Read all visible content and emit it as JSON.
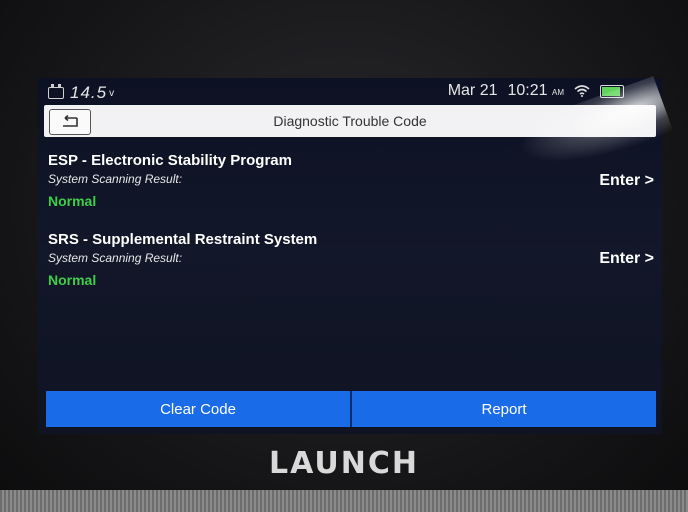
{
  "status_bar": {
    "voltage": "14.5",
    "voltage_unit": "v",
    "date": "Mar 21",
    "time": "10:21",
    "ampm": "AM",
    "battery_level": 0.8
  },
  "header": {
    "title": "Diagnostic Trouble Code"
  },
  "systems": [
    {
      "name": "ESP - Electronic Stability Program",
      "result_label": "System Scanning Result:",
      "result": "Normal",
      "action": "Enter >"
    },
    {
      "name": "SRS - Supplemental Restraint System",
      "result_label": "System Scanning Result:",
      "result": "Normal",
      "action": "Enter >"
    }
  ],
  "footer": {
    "clear_code_label": "Clear Code",
    "report_label": "Report"
  },
  "device": {
    "brand": "LAUNCH"
  },
  "colors": {
    "accent_blue": "#1a6be8",
    "status_normal": "#3ccf48",
    "screen_bg": "#121729"
  }
}
